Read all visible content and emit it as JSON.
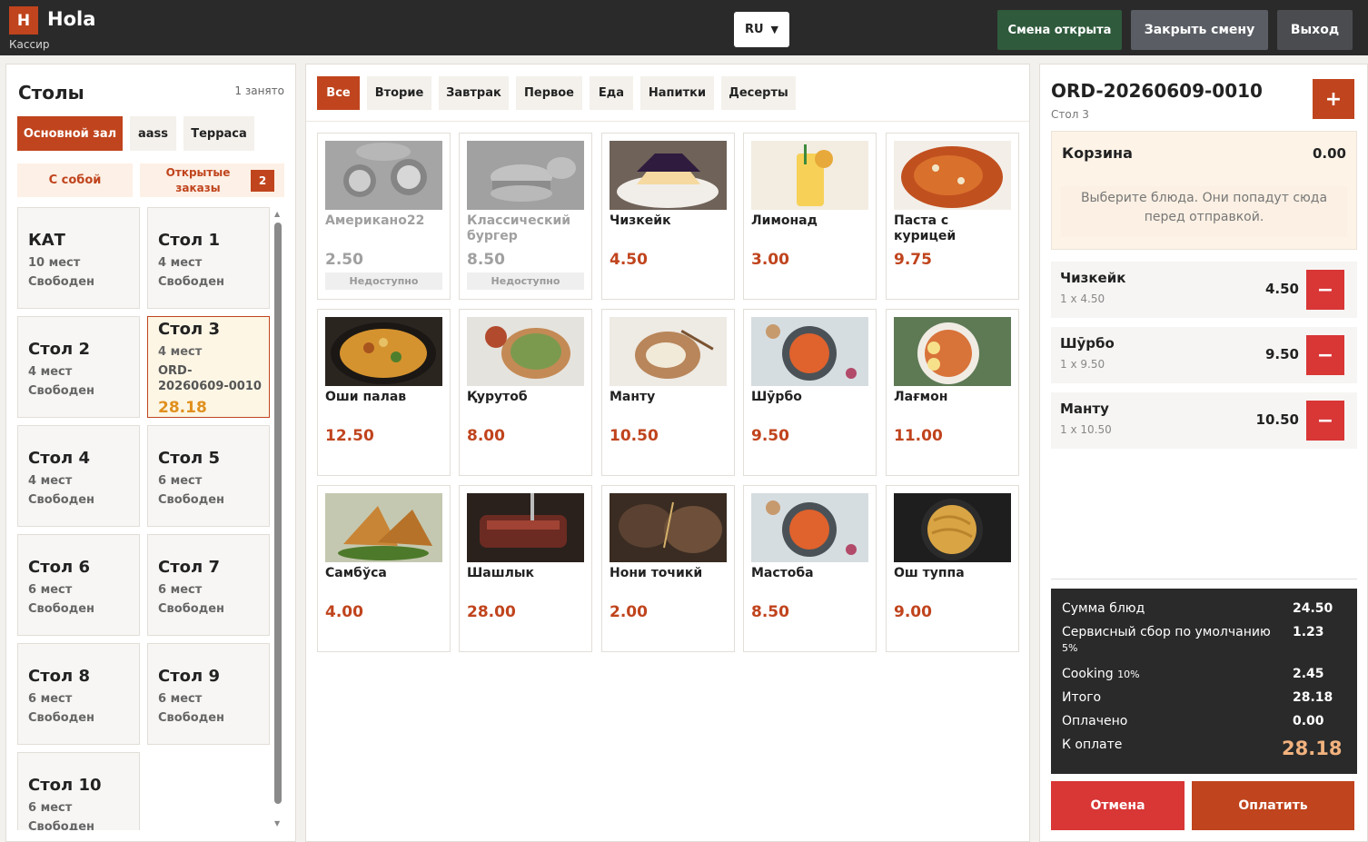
{
  "header": {
    "logo_letter": "H",
    "app_name": "Hola",
    "role": "Кассир",
    "language": "RU",
    "shift_status": "Смена открыта",
    "close_shift": "Закрыть смену",
    "logout": "Выход"
  },
  "tables_panel": {
    "title": "Столы",
    "occupied": "1 занято",
    "zones": [
      "Основной зал",
      "aass",
      "Терраса"
    ],
    "active_zone": "Основной зал",
    "takeaway": "С собой",
    "open_orders_line1": "Открытые",
    "open_orders_line2": "заказы",
    "open_orders_count": "2",
    "tables": [
      {
        "name": "КАТ",
        "seats": "10 мест",
        "status": "Свободен"
      },
      {
        "name": "Стол 1",
        "seats": "4 мест",
        "status": "Свободен"
      },
      {
        "name": "Стол 2",
        "seats": "4 мест",
        "status": "Свободен"
      },
      {
        "name": "Стол 3",
        "seats": "4 мест",
        "order": "ORD-20260609-0010",
        "total": "28.18"
      },
      {
        "name": "Стол 4",
        "seats": "4 мест",
        "status": "Свободен"
      },
      {
        "name": "Стол 5",
        "seats": "6 мест",
        "status": "Свободен"
      },
      {
        "name": "Стол 6",
        "seats": "6 мест",
        "status": "Свободен"
      },
      {
        "name": "Стол 7",
        "seats": "6 мест",
        "status": "Свободен"
      },
      {
        "name": "Стол 8",
        "seats": "6 мест",
        "status": "Свободен"
      },
      {
        "name": "Стол 9",
        "seats": "6 мест",
        "status": "Свободен"
      },
      {
        "name": "Стол 10",
        "seats": "6 мест",
        "status": "Свободен"
      }
    ]
  },
  "menu": {
    "categories": [
      "Все",
      "Вторие",
      "Завтрак",
      "Первое",
      "Еда",
      "Напитки",
      "Десерты"
    ],
    "active_category": "Все",
    "unavailable_label": "Недоступно",
    "dishes": [
      {
        "name": "Американо22",
        "price": "2.50",
        "available": false,
        "icon": "coffee-photo"
      },
      {
        "name": "Классический бургер",
        "price": "8.50",
        "available": false,
        "icon": "burger-photo"
      },
      {
        "name": "Чизкейк",
        "price": "4.50",
        "available": true,
        "icon": "cheesecake-photo"
      },
      {
        "name": "Лимонад",
        "price": "3.00",
        "available": true,
        "icon": "lemonade-photo"
      },
      {
        "name": "Паста с курицей",
        "price": "9.75",
        "available": true,
        "icon": "pasta-photo"
      },
      {
        "name": "Оши палав",
        "price": "12.50",
        "available": true,
        "icon": "plov-photo"
      },
      {
        "name": "Қурутоб",
        "price": "8.00",
        "available": true,
        "icon": "qurutob-photo"
      },
      {
        "name": "Манту",
        "price": "10.50",
        "available": true,
        "icon": "mantu-photo"
      },
      {
        "name": "Шӯрбо",
        "price": "9.50",
        "available": true,
        "icon": "soup-photo"
      },
      {
        "name": "Лағмон",
        "price": "11.00",
        "available": true,
        "icon": "lagman-photo"
      },
      {
        "name": "Самбўса",
        "price": "4.00",
        "available": true,
        "icon": "samosa-photo"
      },
      {
        "name": "Шашлык",
        "price": "28.00",
        "available": true,
        "icon": "shashlik-photo"
      },
      {
        "name": "Нони точикй",
        "price": "2.00",
        "available": true,
        "icon": "bread-photo"
      },
      {
        "name": "Мастоба",
        "price": "8.50",
        "available": true,
        "icon": "soup-photo"
      },
      {
        "name": "Ош туппа",
        "price": "9.00",
        "available": true,
        "icon": "noodles-photo"
      }
    ]
  },
  "order": {
    "number": "ORD-20260609-0010",
    "table": "Стол 3",
    "add_label": "+",
    "cart_title": "Корзина",
    "cart_sum": "0.00",
    "cart_hint": "Выберите блюда. Они попадут сюда перед отправкой.",
    "lines": [
      {
        "name": "Чизкейк",
        "qty": "1 x 4.50",
        "sum": "4.50"
      },
      {
        "name": "Шӯрбо",
        "qty": "1 x 9.50",
        "sum": "9.50"
      },
      {
        "name": "Манту",
        "qty": "1 x 10.50",
        "sum": "10.50"
      }
    ],
    "minus_label": "−",
    "totals": {
      "items_label": "Сумма блюд",
      "items_value": "24.50",
      "service_label": "Сервисный сбор по умолчанию",
      "service_pct": "5%",
      "service_value": "1.23",
      "cooking_label": "Cooking",
      "cooking_pct": "10%",
      "cooking_value": "2.45",
      "total_label": "Итого",
      "total_value": "28.18",
      "paid_label": "Оплачено",
      "paid_value": "0.00",
      "due_label": "К оплате",
      "due_value": "28.18"
    },
    "cancel": "Отмена",
    "pay": "Оплатить"
  },
  "colors": {
    "accent": "#c0441d",
    "danger": "#d93636",
    "dark": "#2a2a2a",
    "shift_green": "#2f5a3c",
    "due_highlight": "#f2b27e"
  }
}
